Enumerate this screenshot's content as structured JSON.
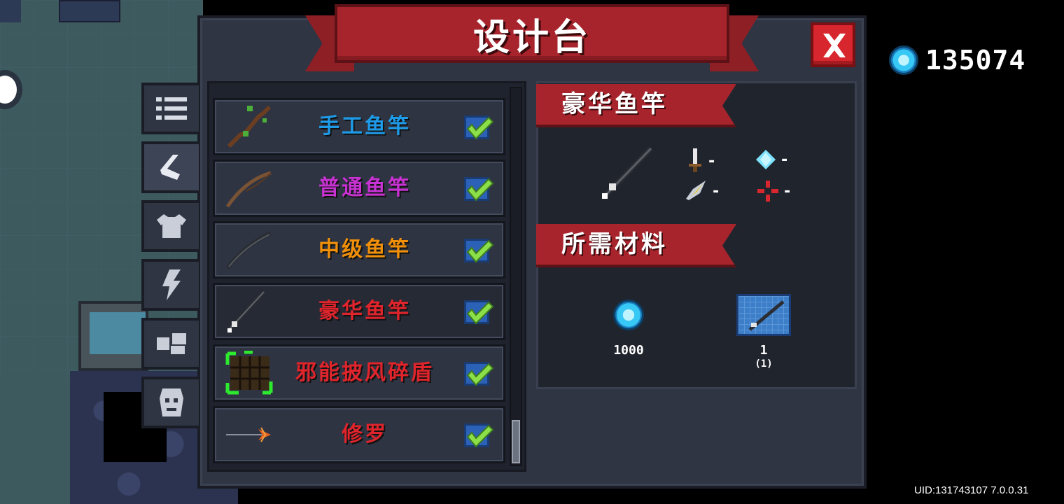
{
  "title": "设计台",
  "currency": {
    "icon": "gem-icon",
    "value": "135074"
  },
  "tabs": [
    {
      "name": "list-icon",
      "active": false
    },
    {
      "name": "weapon-icon",
      "active": true
    },
    {
      "name": "armor-icon",
      "active": false
    },
    {
      "name": "lightning-icon",
      "active": false
    },
    {
      "name": "pet-icon",
      "active": false
    },
    {
      "name": "mask-icon",
      "active": false
    }
  ],
  "items": [
    {
      "label": "手工鱼竿",
      "color": "#1e9be8",
      "icon": "handmade-rod-icon",
      "checked": true
    },
    {
      "label": "普通鱼竿",
      "color": "#c832d2",
      "icon": "normal-rod-icon",
      "checked": true
    },
    {
      "label": "中级鱼竿",
      "color": "#f0900a",
      "icon": "intermediate-rod-icon",
      "checked": true
    },
    {
      "label": "豪华鱼竿",
      "color": "#e0242c",
      "icon": "luxury-rod-icon",
      "checked": true,
      "selected": true
    },
    {
      "label": "邪能披风碎盾",
      "color": "#e0242c",
      "icon": "fel-shield-icon",
      "checked": true
    },
    {
      "label": "修罗",
      "color": "#e0242c",
      "icon": "asura-spear-icon",
      "checked": true
    }
  ],
  "detail": {
    "name": "豪华鱼竿",
    "stats": [
      {
        "icon": "sword-icon",
        "value": "-"
      },
      {
        "icon": "crystal-icon",
        "value": "-"
      },
      {
        "icon": "feather-icon",
        "value": "-"
      },
      {
        "icon": "crosshair-icon",
        "value": "-"
      }
    ]
  },
  "materials": {
    "title": "所需材料",
    "items": [
      {
        "icon": "gem-icon",
        "amount": "1000"
      },
      {
        "icon": "blueprint-icon",
        "amount": "1",
        "owned": "(1)"
      }
    ]
  },
  "footer": {
    "uid": "UID:131743107 7.0.0.31"
  }
}
